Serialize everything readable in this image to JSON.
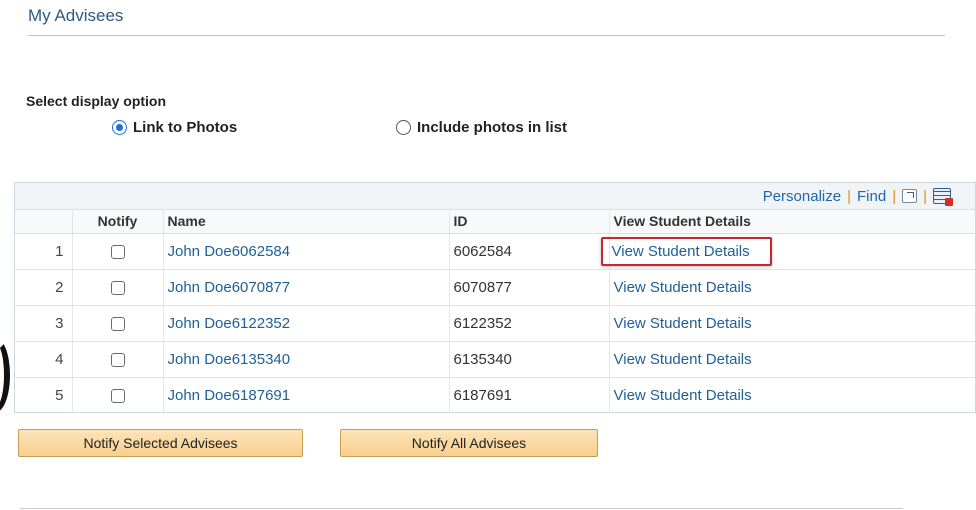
{
  "page": {
    "title": "My Advisees"
  },
  "display_option": {
    "label": "Select display option",
    "options": [
      {
        "label": "Link to Photos",
        "selected": true
      },
      {
        "label": "Include photos in list",
        "selected": false
      }
    ]
  },
  "grid": {
    "toolbar": {
      "personalize": "Personalize",
      "find": "Find",
      "separator": "|"
    },
    "headers": {
      "notify": "Notify",
      "name": "Name",
      "id": "ID",
      "view": "View Student Details"
    },
    "rows": [
      {
        "num": "1",
        "name": "John Doe6062584",
        "id": "6062584",
        "view": "View Student Details",
        "checked": false
      },
      {
        "num": "2",
        "name": "John Doe6070877",
        "id": "6070877",
        "view": "View Student Details",
        "checked": false
      },
      {
        "num": "3",
        "name": "John Doe6122352",
        "id": "6122352",
        "view": "View Student Details",
        "checked": false
      },
      {
        "num": "4",
        "name": "John Doe6135340",
        "id": "6135340",
        "view": "View Student Details",
        "checked": false
      },
      {
        "num": "5",
        "name": "John Doe6187691",
        "id": "6187691",
        "view": "View Student Details",
        "checked": false
      }
    ],
    "icons": {
      "popout": "new-window-icon",
      "download": "download-spreadsheet-icon"
    }
  },
  "buttons": {
    "notify_selected": "Notify Selected Advisees",
    "notify_all": "Notify All Advisees"
  },
  "colors": {
    "title": "#2a5a85",
    "link": "#1f5f99",
    "button_bg": "#f8cf8e",
    "highlight_border": "#c6262c",
    "radio_selected": "#1e6fd9"
  }
}
